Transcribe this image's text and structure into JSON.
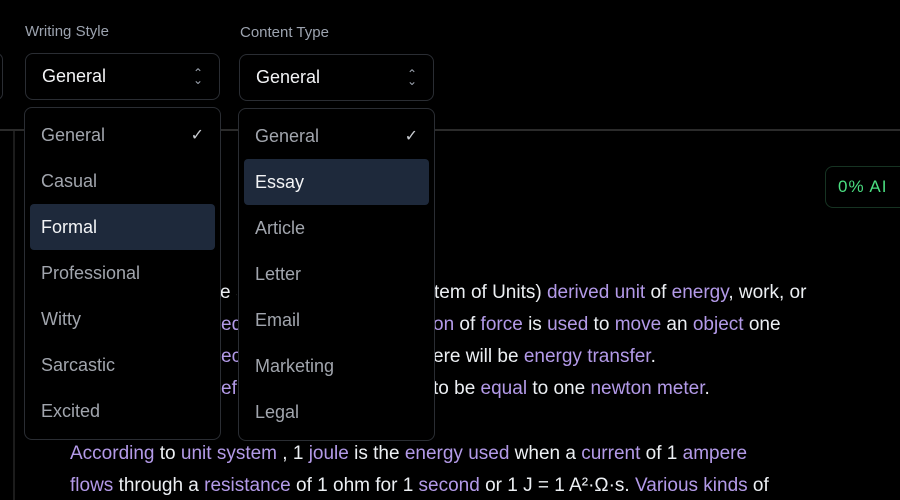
{
  "writing_style": {
    "label": "Writing Style",
    "selected": "General",
    "options": [
      "General",
      "Casual",
      "Formal",
      "Professional",
      "Witty",
      "Sarcastic",
      "Excited"
    ],
    "checked": "General",
    "highlighted": "Formal"
  },
  "content_type": {
    "label": "Content Type",
    "selected": "General",
    "options": [
      "General",
      "Essay",
      "Article",
      "Letter",
      "Email",
      "Marketing",
      "Legal"
    ],
    "checked": "General",
    "highlighted": "Essay"
  },
  "ai_badge": "0% AI",
  "colors": {
    "highlight_word": "#b39ae8",
    "badge": "#4ade80",
    "menu_highlight": "#1e293b"
  },
  "text_lines": [
    [
      [
        "e S",
        false
      ]
    ],
    [
      [
        "ed",
        true
      ]
    ],
    [
      [
        "ec",
        true
      ]
    ],
    [
      [
        "efi",
        true
      ]
    ],
    [
      [
        "tem of Units) ",
        false
      ],
      [
        "derived unit",
        true
      ],
      [
        " of ",
        false
      ],
      [
        "energy",
        true
      ],
      [
        ", work, or",
        false
      ]
    ],
    [
      [
        "on",
        true
      ],
      [
        " of ",
        false
      ],
      [
        "force",
        true
      ],
      [
        " is ",
        false
      ],
      [
        "used",
        true
      ],
      [
        " to ",
        false
      ],
      [
        "move",
        true
      ],
      [
        " an ",
        false
      ],
      [
        "object",
        true
      ],
      [
        " one",
        false
      ]
    ],
    [
      [
        "ere will be ",
        false
      ],
      [
        "energy transfer",
        true
      ],
      [
        ".",
        false
      ]
    ],
    [
      [
        "to be ",
        false
      ],
      [
        "equal",
        true
      ],
      [
        " to one ",
        false
      ],
      [
        "newton meter",
        true
      ],
      [
        ".",
        false
      ]
    ],
    [
      [
        "According",
        true
      ],
      [
        " to ",
        false
      ],
      [
        "unit system",
        true
      ],
      [
        " , 1 ",
        false
      ],
      [
        "joule",
        true
      ],
      [
        " is the ",
        false
      ],
      [
        "energy used",
        true
      ],
      [
        " when a ",
        false
      ],
      [
        "current",
        true
      ],
      [
        " of 1 ",
        false
      ],
      [
        "ampere",
        true
      ]
    ],
    [
      [
        "flows",
        true
      ],
      [
        " through a ",
        false
      ],
      [
        "resistance",
        true
      ],
      [
        " of 1 ohm for 1 ",
        false
      ],
      [
        "second",
        true
      ],
      [
        " or 1 J = 1 A²·Ω·s. ",
        false
      ],
      [
        "Various kinds",
        true
      ],
      [
        " of",
        false
      ]
    ]
  ]
}
